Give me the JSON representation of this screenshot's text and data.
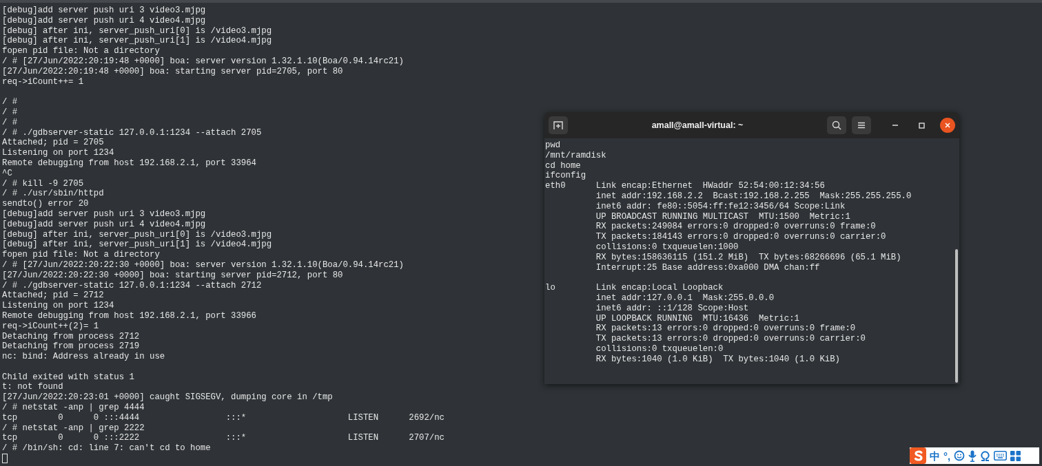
{
  "left_terminal": {
    "blocks": [
      [
        "[debug]add server push uri 3 video3.mjpg",
        "[debug]add server push uri 4 video4.mjpg",
        "[debug] after ini, server_push_uri[0] is /video3.mjpg",
        "[debug] after ini, server_push_uri[1] is /video4.mjpg",
        "fopen pid file: Not a directory",
        "/ # [27/Jun/2022:20:19:48 +0000] boa: server version 1.32.1.10(Boa/0.94.14rc21)",
        "[27/Jun/2022:20:19:48 +0000] boa: starting server pid=2705, port 80",
        "req->iCount++= 1"
      ],
      [
        "/ #",
        "/ #",
        "/ #",
        "/ # ./gdbserver-static 127.0.0.1:1234 --attach 2705",
        "Attached; pid = 2705",
        "Listening on port 1234",
        "Remote debugging from host 192.168.2.1, port 33964",
        "^C",
        "/ # kill -9 2705",
        "/ # ./usr/sbin/httpd",
        "sendto() error 20",
        "[debug]add server push uri 3 video3.mjpg",
        "[debug]add server push uri 4 video4.mjpg",
        "[debug] after ini, server_push_uri[0] is /video3.mjpg",
        "[debug] after ini, server_push_uri[1] is /video4.mjpg",
        "fopen pid file: Not a directory",
        "/ # [27/Jun/2022:20:22:30 +0000] boa: server version 1.32.1.10(Boa/0.94.14rc21)",
        "[27/Jun/2022:20:22:30 +0000] boa: starting server pid=2712, port 80",
        "/ # ./gdbserver-static 127.0.0.1:1234 --attach 2712",
        "Attached; pid = 2712",
        "Listening on port 1234",
        "Remote debugging from host 192.168.2.1, port 33966",
        "req->iCount++(2)= 1",
        "Detaching from process 2712",
        "Detaching from process 2719",
        "nc: bind: Address already in use"
      ],
      [
        "Child exited with status 1",
        "t: not found",
        "[27/Jun/2022:20:23:01 +0000] caught SIGSEGV, dumping core in /tmp",
        "/ # netstat -anp | grep 4444",
        "tcp        0      0 :::4444                 :::*                    LISTEN      2692/nc",
        "/ # netstat -anp | grep 2222",
        "tcp        0      0 :::2222                 :::*                    LISTEN      2707/nc",
        "/ # /bin/sh: cd: line 7: can't cd to home"
      ]
    ],
    "cursor": true
  },
  "terminal_window": {
    "title": "amall@amall-virtual: ~",
    "blocks": [
      [
        "pwd",
        "/mnt/ramdisk",
        "cd home",
        "ifconfig",
        "eth0      Link encap:Ethernet  HWaddr 52:54:00:12:34:56",
        "          inet addr:192.168.2.2  Bcast:192.168.2.255  Mask:255.255.255.0",
        "          inet6 addr: fe80::5054:ff:fe12:3456/64 Scope:Link",
        "          UP BROADCAST RUNNING MULTICAST  MTU:1500  Metric:1",
        "          RX packets:249084 errors:0 dropped:0 overruns:0 frame:0",
        "          TX packets:184143 errors:0 dropped:0 overruns:0 carrier:0",
        "          collisions:0 txqueuelen:1000",
        "          RX bytes:158636115 (151.2 MiB)  TX bytes:68266696 (65.1 MiB)",
        "          Interrupt:25 Base address:0xa000 DMA chan:ff"
      ],
      [
        "lo        Link encap:Local Loopback",
        "          inet addr:127.0.0.1  Mask:255.0.0.0",
        "          inet6 addr: ::1/128 Scope:Host",
        "          UP LOOPBACK RUNNING  MTU:16436  Metric:1",
        "          RX packets:13 errors:0 dropped:0 overruns:0 frame:0",
        "          TX packets:13 errors:0 dropped:0 overruns:0 carrier:0",
        "          collisions:0 txqueuelen:0",
        "          RX bytes:1040 (1.0 KiB)  TX bytes:1040 (1.0 KiB)"
      ]
    ]
  },
  "ime_toolbar": {
    "items": [
      {
        "kind": "logo"
      },
      {
        "kind": "text",
        "text": "中"
      },
      {
        "kind": "text",
        "text": "°,"
      },
      {
        "kind": "emoji"
      },
      {
        "kind": "voice"
      },
      {
        "kind": "symbols"
      },
      {
        "kind": "keyboard"
      },
      {
        "kind": "toolbox"
      }
    ]
  }
}
